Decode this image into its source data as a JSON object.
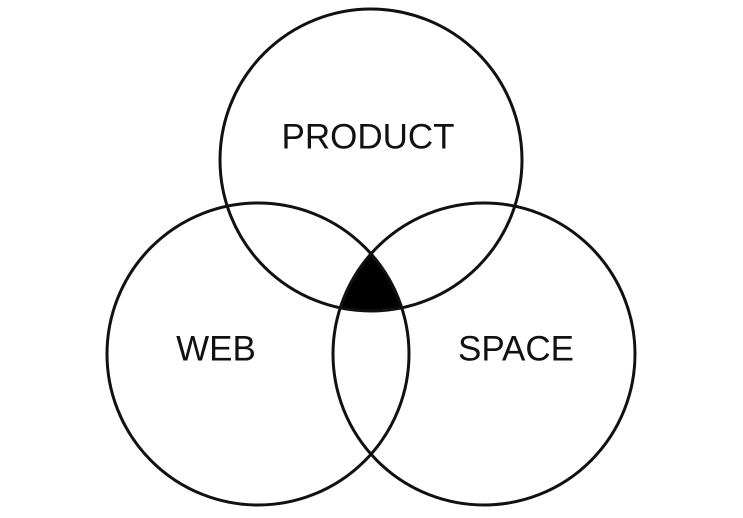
{
  "diagram": {
    "type": "venn-3",
    "sets": [
      {
        "id": "product",
        "label": "PRODUCT"
      },
      {
        "id": "web",
        "label": "WEB"
      },
      {
        "id": "space",
        "label": "SPACE"
      }
    ],
    "highlight": {
      "region": "product∩web∩space",
      "color": "#000000"
    },
    "stroke_color": "#111111",
    "background": "#ffffff"
  }
}
